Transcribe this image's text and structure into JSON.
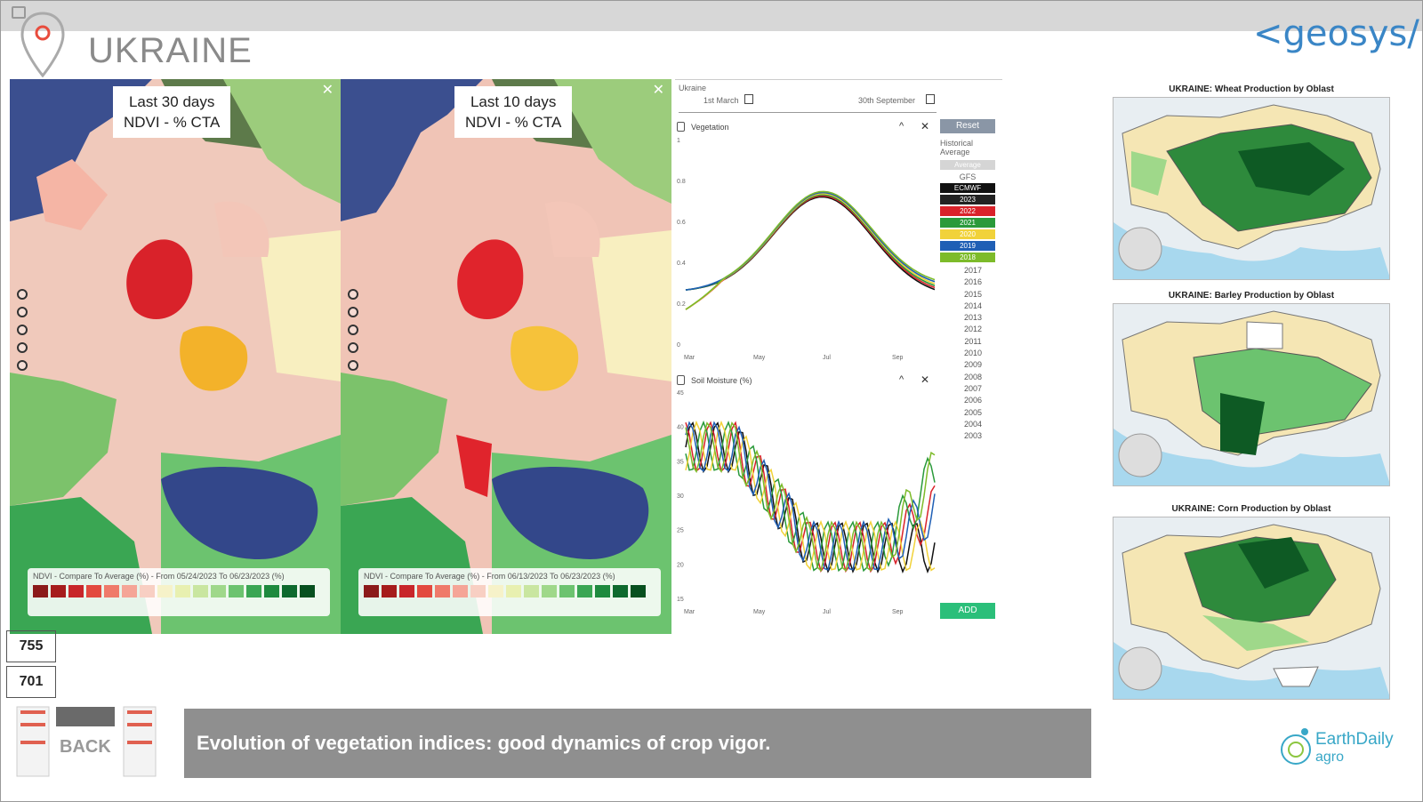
{
  "header": {
    "title": "UKRAINE",
    "brand": "<geosys/>",
    "pin_icon": "location-pin-icon"
  },
  "maps": [
    {
      "label_line1": "Last 30 days",
      "label_line2": "NDVI - % CTA",
      "legend_title": "NDVI - Compare To Average (%) - From 05/24/2023 To 06/23/2023 (%)"
    },
    {
      "label_line1": "Last 10 days",
      "label_line2": "NDVI - % CTA",
      "legend_title": "NDVI - Compare To Average (%) - From 06/13/2023 To 06/23/2023 (%)"
    }
  ],
  "legend_colors": [
    "#8b1a1a",
    "#a61c1c",
    "#c8262a",
    "#e34a3f",
    "#ef7a6a",
    "#f5a597",
    "#f8cfc3",
    "#f6f2c9",
    "#e8f0b0",
    "#c9e6a0",
    "#9fd88a",
    "#6cc36f",
    "#3aa653",
    "#1e8a3e",
    "#0e6a2e",
    "#07501f"
  ],
  "chart_panel": {
    "region": "Ukraine",
    "date_start": "1st March",
    "date_end": "30th September",
    "vegetation_title": "Vegetation",
    "soil_title": "Soil Moisture (%)",
    "reset_label": "Reset",
    "historical_label": "Historical Average",
    "average_label": "Average",
    "gfs_label": "GFS",
    "add_label": "ADD",
    "veg_y_ticks": [
      "1",
      "0.8",
      "0.6",
      "0.4",
      "0.2",
      "0"
    ],
    "soil_y_ticks": [
      "45",
      "40",
      "35",
      "30",
      "25",
      "20",
      "15"
    ],
    "x_ticks": [
      "Mar",
      "May",
      "Jul",
      "Sep"
    ],
    "model_buttons": [
      {
        "label": "ECMWF",
        "color": "#111111"
      },
      {
        "label": "2023",
        "color": "#222222"
      },
      {
        "label": "2022",
        "color": "#d9222a"
      },
      {
        "label": "2021",
        "color": "#2a9a3a"
      },
      {
        "label": "2020",
        "color": "#f1d23a"
      },
      {
        "label": "2019",
        "color": "#1f5fb5"
      },
      {
        "label": "2018",
        "color": "#7dbb2a"
      }
    ],
    "years": [
      "2017",
      "2016",
      "2015",
      "2014",
      "2013",
      "2012",
      "2011",
      "2010",
      "2009",
      "2008",
      "2007",
      "2006",
      "2005",
      "2004",
      "2003"
    ]
  },
  "right_maps": [
    {
      "title": "UKRAINE: Wheat Production by Oblast"
    },
    {
      "title": "UKRAINE: Barley Production by Oblast"
    },
    {
      "title": "UKRAINE: Corn Production by Oblast"
    }
  ],
  "counters": [
    "755",
    "701"
  ],
  "back_label": "BACK",
  "caption": "Evolution of vegetation indices: good dynamics of crop vigor.",
  "earthdaily": {
    "line1": "EarthDaily",
    "line2": "agro"
  }
}
